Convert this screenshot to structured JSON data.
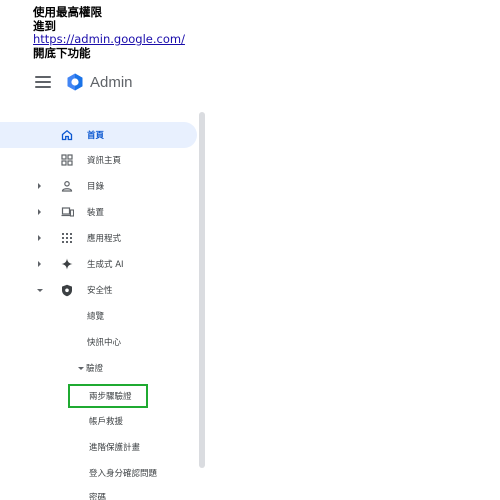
{
  "note": {
    "line1": "使用最高權限",
    "line2": "進到",
    "link": "https://admin.google.com/",
    "line3": "開底下功能"
  },
  "header": {
    "app_name": "Admin"
  },
  "nav": {
    "home": "首頁",
    "dashboard": "資訊主頁",
    "directory": "目錄",
    "devices": "裝置",
    "apps": "應用程式",
    "gen_ai": "生成式 AI",
    "security": "安全性",
    "overview": "總覽",
    "alert_center": "快訊中心",
    "authentication": "驗證",
    "two_step": "兩步驟驗證",
    "account_recovery": "帳戶救援",
    "advanced_protection": "進階保護計畫",
    "login_challenge": "登入身分確認問題",
    "passwords": "密碼"
  },
  "colors": {
    "active_bg": "#e8f0fe",
    "active_text": "#0b57d0",
    "highlight_border": "#1faa31",
    "link": "#1a0dab"
  }
}
